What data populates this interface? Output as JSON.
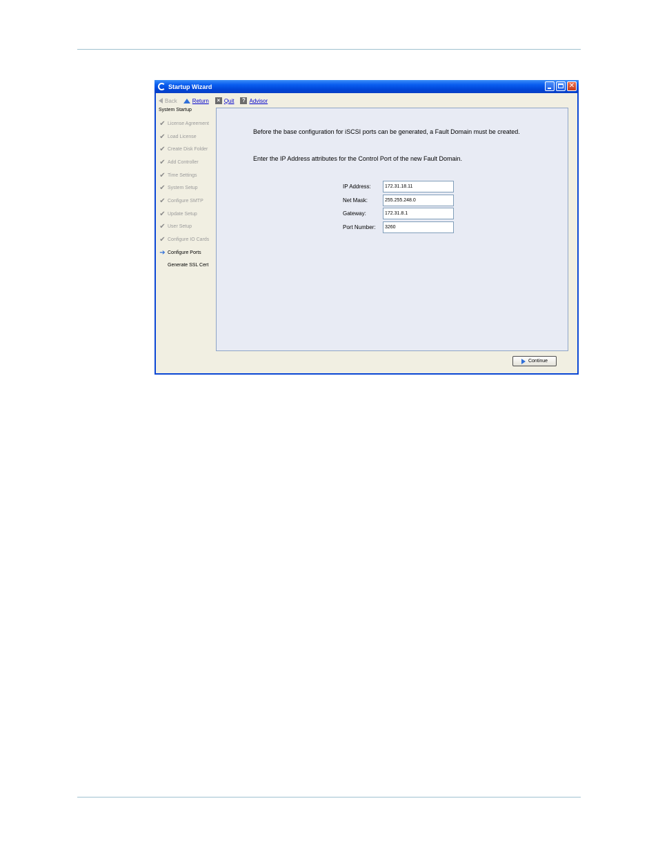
{
  "window": {
    "title": "Startup Wizard",
    "accent": "#0a46d4"
  },
  "toolbar": {
    "back": "Back",
    "return": "Return",
    "quit": "Quit",
    "advisor": "Advisor"
  },
  "sidebar": {
    "heading": "System Startup",
    "items": [
      {
        "label": "License Agreement",
        "state": "done"
      },
      {
        "label": "Load License",
        "state": "done"
      },
      {
        "label": "Create Disk Folder",
        "state": "done"
      },
      {
        "label": "Add Controller",
        "state": "done"
      },
      {
        "label": "Time Settings",
        "state": "done"
      },
      {
        "label": "System Setup",
        "state": "done"
      },
      {
        "label": "Configure SMTP",
        "state": "done"
      },
      {
        "label": "Update Setup",
        "state": "done"
      },
      {
        "label": "User Setup",
        "state": "done"
      },
      {
        "label": "Configure IO Cards",
        "state": "done"
      },
      {
        "label": "Configure Ports",
        "state": "current"
      },
      {
        "label": "Generate SSL Cert",
        "state": "pending"
      }
    ]
  },
  "main": {
    "message1": "Before the base configuration for iSCSI ports can be generated, a Fault Domain must be created.",
    "message2": "Enter the IP Address attributes for the Control Port of the new Fault Domain.",
    "fields": [
      {
        "label": "IP Address:",
        "value": "172.31.18.11"
      },
      {
        "label": "Net Mask:",
        "value": "255.255.248.0"
      },
      {
        "label": "Gateway:",
        "value": "172.31.8.1"
      },
      {
        "label": "Port Number:",
        "value": "3260"
      }
    ]
  },
  "footer": {
    "continue": "Continue"
  }
}
